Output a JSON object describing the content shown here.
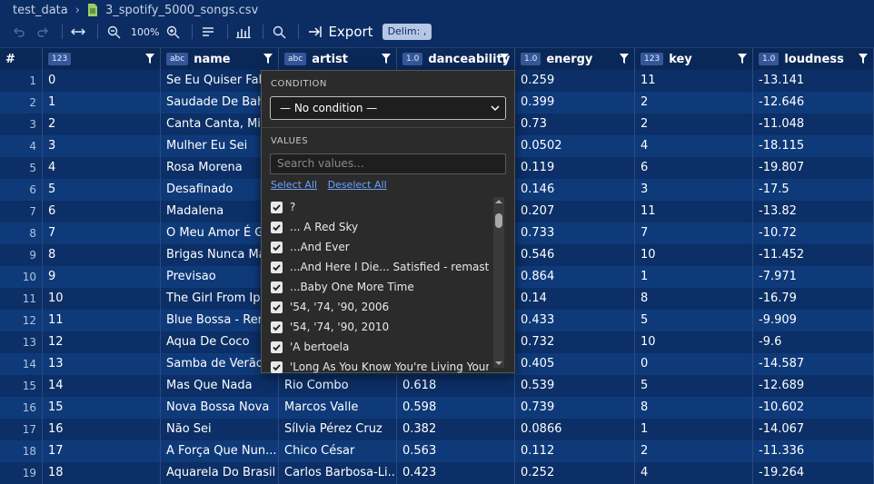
{
  "breadcrumb": {
    "folder": "test_data",
    "file": "3_spotify_5000_songs.csv"
  },
  "toolbar": {
    "zoom": "100%",
    "export_label": "Export",
    "delim_label": "Delim: ,"
  },
  "columns": [
    {
      "label": "#",
      "type": ""
    },
    {
      "label": "",
      "type": "123"
    },
    {
      "label": "name",
      "type": "abc"
    },
    {
      "label": "artist",
      "type": "abc"
    },
    {
      "label": "danceability",
      "type": "1.0"
    },
    {
      "label": "energy",
      "type": "1.0"
    },
    {
      "label": "key",
      "type": "123"
    },
    {
      "label": "loudness",
      "type": "1.0"
    }
  ],
  "rows": [
    [
      "1",
      "0",
      "Se Eu Quiser Falar",
      "",
      "",
      "0.259",
      "11",
      "-13.141"
    ],
    [
      "2",
      "1",
      "Saudade De Bahia",
      "",
      "",
      "0.399",
      "2",
      "-12.646"
    ],
    [
      "3",
      "2",
      "Canta Canta, Minha",
      "",
      "",
      "0.73",
      "2",
      "-11.048"
    ],
    [
      "4",
      "3",
      "Mulher Eu Sei",
      "",
      "",
      "0.0502",
      "4",
      "-18.115"
    ],
    [
      "5",
      "4",
      "Rosa Morena",
      "",
      "",
      "0.119",
      "6",
      "-19.807"
    ],
    [
      "6",
      "5",
      "Desafinado",
      "",
      "",
      "0.146",
      "3",
      "-17.5"
    ],
    [
      "7",
      "6",
      "Madalena",
      "",
      "",
      "0.207",
      "11",
      "-13.82"
    ],
    [
      "8",
      "7",
      "O Meu Amor É Gló",
      "",
      "",
      "0.733",
      "7",
      "-10.72"
    ],
    [
      "9",
      "8",
      "Brigas Nunca Mais",
      "",
      "",
      "0.546",
      "10",
      "-11.452"
    ],
    [
      "10",
      "9",
      "Previsao",
      "",
      "",
      "0.864",
      "1",
      "-7.971"
    ],
    [
      "11",
      "10",
      "The Girl From Ipan",
      "",
      "",
      "0.14",
      "8",
      "-16.79"
    ],
    [
      "12",
      "11",
      "Blue Bossa - Rem",
      "",
      "",
      "0.433",
      "5",
      "-9.909"
    ],
    [
      "13",
      "12",
      "Aqua De Coco",
      "",
      "",
      "0.732",
      "10",
      "-9.6"
    ],
    [
      "14",
      "13",
      "Samba de Verão",
      "",
      "",
      "0.405",
      "0",
      "-14.587"
    ],
    [
      "15",
      "14",
      "Mas Que Nada",
      "Rio Combo",
      "0.618",
      "0.539",
      "5",
      "-12.689"
    ],
    [
      "16",
      "15",
      "Nova Bossa Nova",
      "Marcos Valle",
      "0.598",
      "0.739",
      "8",
      "-10.602"
    ],
    [
      "17",
      "16",
      "Não Sei",
      "Sílvia Pérez Cruz",
      "0.382",
      "0.0866",
      "1",
      "-14.067"
    ],
    [
      "18",
      "17",
      "A Força Que Nun...",
      "Chico César",
      "0.563",
      "0.112",
      "2",
      "-11.336"
    ],
    [
      "19",
      "18",
      "Aquarela Do Brasil",
      "Carlos Barbosa-Li...",
      "0.423",
      "0.252",
      "4",
      "-19.264"
    ]
  ],
  "filter_popup": {
    "condition_label": "CONDITION",
    "condition_value": "— No condition —",
    "values_label": "VALUES",
    "search_placeholder": "Search values...",
    "select_all": "Select All",
    "deselect_all": "Deselect All",
    "values": [
      "?",
      "... A Red Sky",
      "...And Ever",
      "...And Here I Die... Satisfied - remastered...",
      "...Baby One More Time",
      "'54, '74, '90, 2006",
      "'54, '74, '90, 2010",
      "'A bertoela",
      "'Long As You Know You're Living Yours"
    ]
  },
  "colors": {
    "background": "#0b2d63",
    "row_even": "#0f3a7a",
    "row_odd": "#0b2f66",
    "popup_bg": "#2b2b2b",
    "link": "#6aa3ff"
  }
}
